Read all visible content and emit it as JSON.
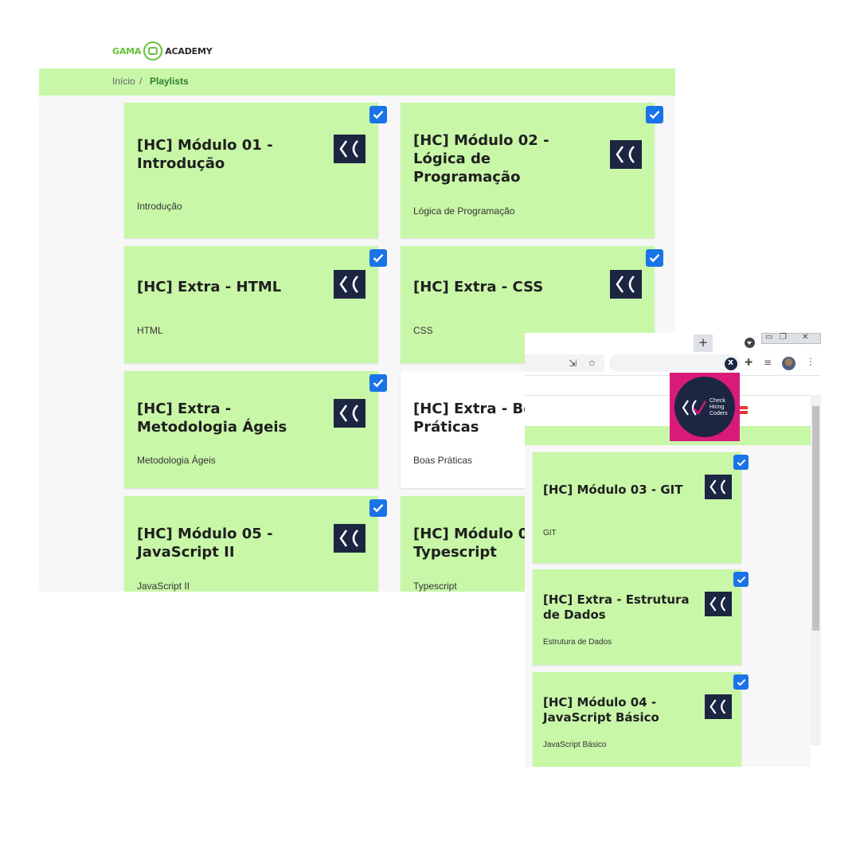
{
  "site": {
    "logo_left": "GAMA",
    "logo_right": "ACADEMY",
    "breadcrumb": {
      "home": "Início",
      "separator": "/",
      "current": "Playlists"
    }
  },
  "cards": [
    {
      "title": "[HC] Módulo 01 - Introdução",
      "subtitle": "Introdução",
      "checked": true
    },
    {
      "title": "[HC] Módulo 02 - Lógica de Programação",
      "subtitle": "Lógica de Programação",
      "checked": true
    },
    {
      "title": "[HC] Extra - HTML",
      "subtitle": "HTML",
      "checked": true
    },
    {
      "title": "[HC] Extra - CSS",
      "subtitle": "CSS",
      "checked": true
    },
    {
      "title": "[HC] Extra - Metodologia Ágeis",
      "subtitle": "Metodologia Ágeis",
      "checked": true
    },
    {
      "title": "[HC] Extra - Boas Práticas",
      "subtitle": "Boas Práticas",
      "checked": false
    },
    {
      "title": "[HC] Módulo 05 - JavaScript II",
      "subtitle": "JavaScript II",
      "checked": true
    },
    {
      "title": "[HC] Módulo 06 - Typescript",
      "subtitle": "Typescript",
      "checked": false
    }
  ],
  "browser": {
    "new_tab": "+",
    "extension_popup": {
      "line1": "Check",
      "line2": "Hiring",
      "line3": "Coders"
    },
    "cards": [
      {
        "title": "[HC] Módulo 03 - GIT",
        "subtitle": "GIT",
        "checked": true
      },
      {
        "title": "[HC] Extra - Estrutura de Dados",
        "subtitle": "Estrutura de Dados",
        "checked": true
      },
      {
        "title": "[HC] Módulo 04 - JavaScript Básico",
        "subtitle": "JavaScript Básico",
        "checked": true
      }
    ]
  },
  "colors": {
    "card_green": "#c8f7a8",
    "check_blue": "#1a73e8",
    "logo_navy": "#1c2541",
    "brand_green": "#66c23a",
    "popup_pink": "#d81b78"
  },
  "icons": [
    "hiring-coders-logo-icon",
    "checkbox-checked-icon",
    "puzzle-icon",
    "media-icon",
    "kebab-icon"
  ]
}
